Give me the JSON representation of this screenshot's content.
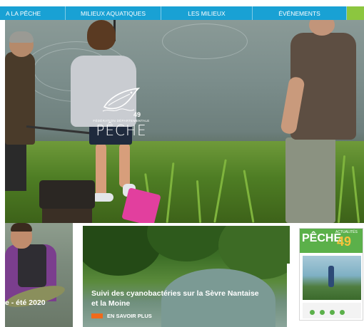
{
  "nav": {
    "items": [
      {
        "label": "A LA PÊCHE"
      },
      {
        "label": "MILIEUX AQUATIQUES"
      },
      {
        "label": "LES MILIEUX"
      },
      {
        "label": "ÉVÉNEMENTS"
      }
    ],
    "accent_color": "#8cc63f",
    "bar_color": "#19a1d4"
  },
  "hero": {
    "logo": {
      "icon": "fish-logo-icon",
      "subtitle": "FÉDÉRATION DÉPARTEMENTALE",
      "number": "49",
      "title": "PÊCHE"
    }
  },
  "cards": [
    {
      "caption": "e - été 2020"
    },
    {
      "caption": "Suivi des cyanobactéries sur la Sèvre Nantaise et la Moine",
      "more_label": "EN SAVOIR PLUS",
      "more_color": "#ef6a1b"
    },
    {
      "magazine": {
        "title": "PÊCHE",
        "tag": "ACTUALITÉS",
        "number": "49"
      }
    }
  ]
}
